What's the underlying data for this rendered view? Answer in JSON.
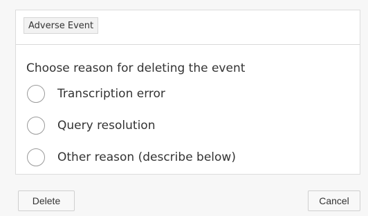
{
  "panel": {
    "tag": "Adverse Event",
    "prompt": "Choose reason for deleting the event",
    "options": [
      {
        "label": "Transcription error",
        "selected": false
      },
      {
        "label": "Query resolution",
        "selected": false
      },
      {
        "label": "Other reason (describe below)",
        "selected": false
      }
    ]
  },
  "actions": {
    "delete_label": "Delete",
    "cancel_label": "Cancel"
  }
}
